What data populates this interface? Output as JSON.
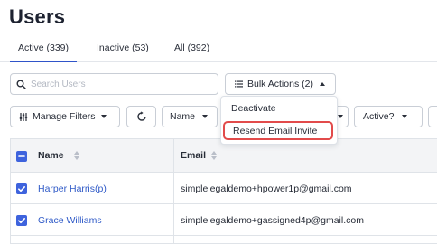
{
  "page": {
    "title": "Users"
  },
  "tabs": [
    {
      "label": "Active (339)",
      "active": true
    },
    {
      "label": "Inactive (53)",
      "active": false
    },
    {
      "label": "All (392)",
      "active": false
    }
  ],
  "search": {
    "placeholder": "Search Users",
    "value": ""
  },
  "toolbar": {
    "bulk_actions_label": "Bulk Actions (2)",
    "manage_filters_label": "Manage Filters",
    "name_filter_label": "Name",
    "active_filter_label": "Active?"
  },
  "bulk_menu": {
    "items": [
      {
        "label": "Deactivate",
        "highlighted": false
      },
      {
        "label": "Resend Email Invite",
        "highlighted": true
      }
    ]
  },
  "table": {
    "columns": [
      "Name",
      "Email"
    ],
    "rows": [
      {
        "name": "Harper Harris(p)",
        "email": "simplelegaldemo+hpower1p@gmail.com",
        "checked": true
      },
      {
        "name": "Grace Williams",
        "email": "simplelegaldemo+gassigned4p@gmail.com",
        "checked": true
      }
    ]
  },
  "colors": {
    "accent": "#3e63dd",
    "link": "#2e59c7",
    "highlight_border": "#e24b4b",
    "header_bg": "#f3f4f6"
  },
  "icons": [
    "search-icon",
    "list-icon",
    "filter-icon",
    "refresh-icon",
    "caret-down-icon",
    "caret-up-icon",
    "sort-icon",
    "checkbox-checked-icon",
    "checkbox-indeterminate-icon"
  ]
}
